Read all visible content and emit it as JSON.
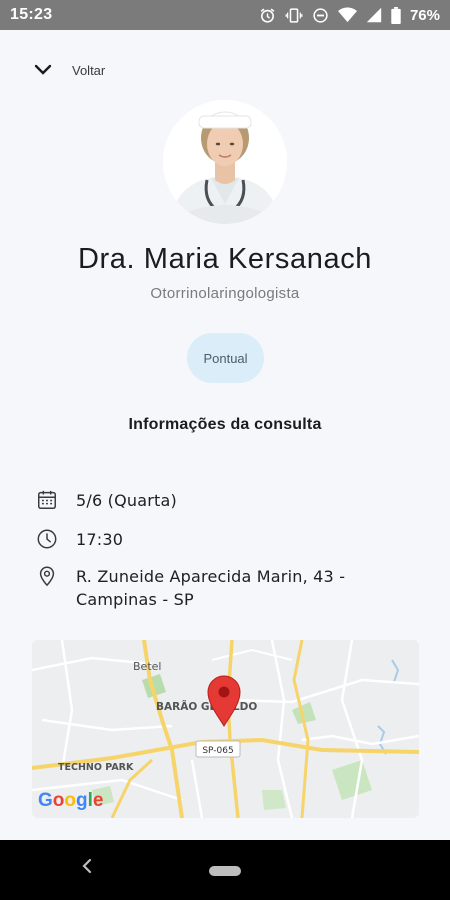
{
  "status_bar": {
    "time": "15:23",
    "battery": "76%",
    "icons": [
      "alarm-icon",
      "vibrate-icon",
      "dnd-icon",
      "wifi-icon",
      "signal-icon",
      "battery-icon"
    ]
  },
  "header": {
    "back_label": "Voltar",
    "back_icon": "chevron-down-icon"
  },
  "doctor": {
    "name": "Dra. Maria Kersanach",
    "specialty": "Otorrinolaringologista",
    "badge": "Pontual"
  },
  "consultation": {
    "title": "Informações da consulta",
    "date": "5/6 (Quarta)",
    "time": "17:30",
    "address_line1": "R. Zuneide Aparecida Marin, 43 -",
    "address_line2": "Campinas - SP"
  },
  "map": {
    "labels": {
      "betel": "Betel",
      "barao": "BARÃO GERALDO",
      "techno": "TECHNO PARK",
      "road": "SP-065"
    },
    "logo": "Google",
    "pin_color": "#e53935"
  },
  "colors": {
    "background": "#f6f7fb",
    "badge_bg": "#daedf8",
    "status_bar": "#7b7b7b"
  }
}
